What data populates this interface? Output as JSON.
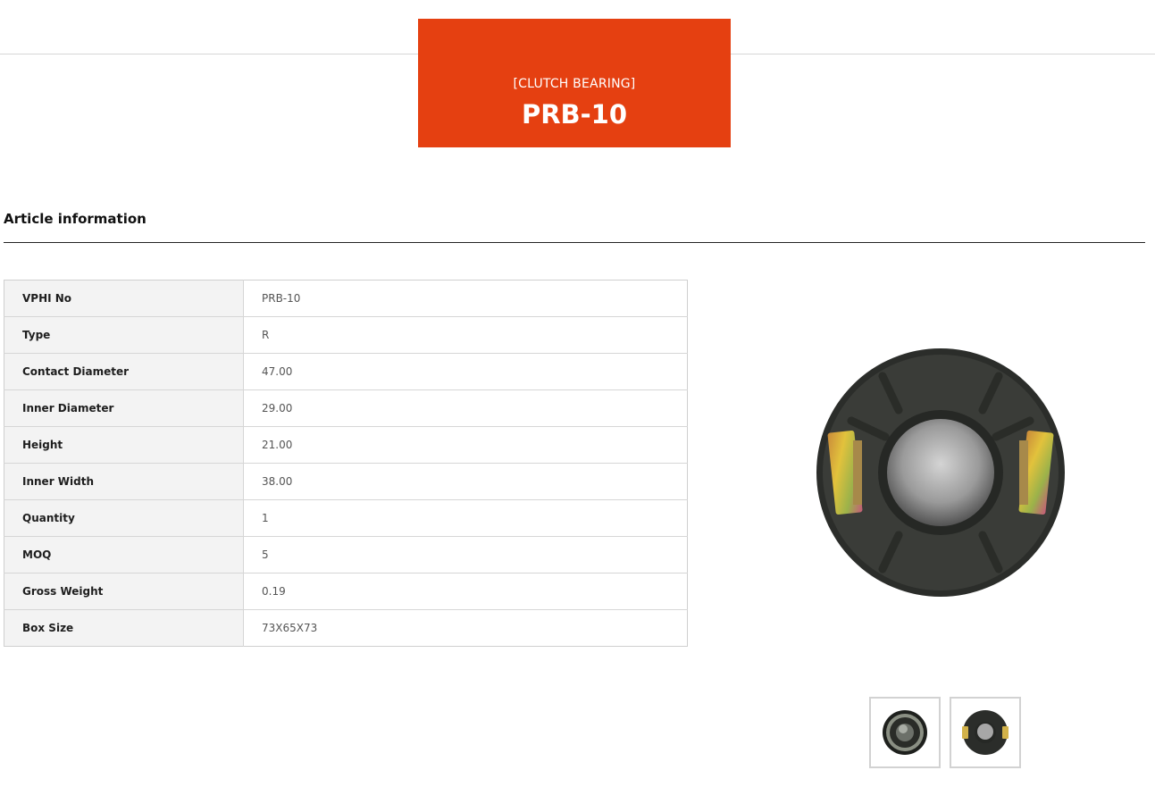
{
  "product": {
    "category": "[CLUTCH BEARING]",
    "code": "PRB-10"
  },
  "article": {
    "heading": "Article information",
    "rows": [
      {
        "label": "VPHI No",
        "value": "PRB-10"
      },
      {
        "label": "Type",
        "value": "R"
      },
      {
        "label": "Contact Diameter",
        "value": "47.00"
      },
      {
        "label": "Inner Diameter",
        "value": "29.00"
      },
      {
        "label": "Height",
        "value": "21.00"
      },
      {
        "label": "Inner Width",
        "value": "38.00"
      },
      {
        "label": "Quantity",
        "value": "1"
      },
      {
        "label": "MOQ",
        "value": "5"
      },
      {
        "label": "Gross Weight",
        "value": "0.19"
      },
      {
        "label": "Box Size",
        "value": "73X65X73"
      }
    ]
  },
  "gallery": {
    "thumbnails": [
      "bearing-side-view-thumbnail",
      "bearing-front-view-thumbnail"
    ]
  },
  "colors": {
    "accent": "#e54011",
    "table_key_bg": "#f3f3f3",
    "border": "#d6d6d6"
  }
}
